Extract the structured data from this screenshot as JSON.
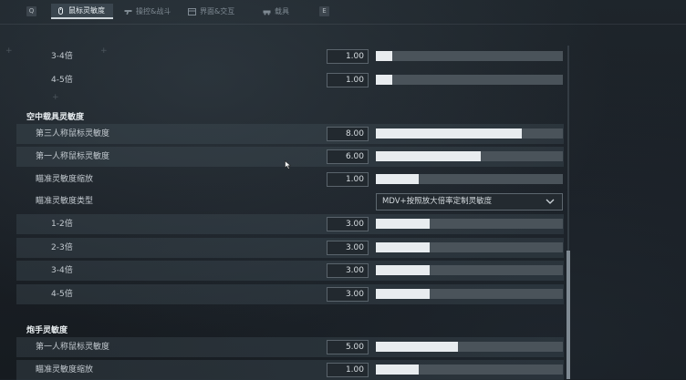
{
  "tabs": {
    "left_key": "Q",
    "right_key": "E",
    "items": [
      {
        "label": "鼠标灵敏度",
        "icon": "mouse-icon",
        "active": true
      },
      {
        "label": "操控&战斗",
        "icon": "gun-icon",
        "active": false
      },
      {
        "label": "界面&交互",
        "icon": "interface-icon",
        "active": false
      },
      {
        "label": "载具",
        "icon": "vehicle-icon",
        "active": false
      }
    ]
  },
  "rows_top": [
    {
      "label": "3-4倍",
      "value": "1.00",
      "fraction": 0.09
    },
    {
      "label": "4-5倍",
      "value": "1.00",
      "fraction": 0.09
    }
  ],
  "section_air": {
    "title": "空中载具灵敏度",
    "rows": [
      {
        "label": "第三人称鼠标灵敏度",
        "value": "8.00",
        "fraction": 0.78
      },
      {
        "label": "第一人称鼠标灵敏度",
        "value": "6.00",
        "fraction": 0.56
      },
      {
        "label": "瞄准灵敏度缩放",
        "value": "1.00",
        "fraction": 0.23
      }
    ],
    "type_label": "瞄准灵敏度类型",
    "type_value": "MDV+按照放大倍率定制灵敏度",
    "scope_rows": [
      {
        "label": "1-2倍",
        "value": "3.00",
        "fraction": 0.29
      },
      {
        "label": "2-3倍",
        "value": "3.00",
        "fraction": 0.29
      },
      {
        "label": "3-4倍",
        "value": "3.00",
        "fraction": 0.29
      },
      {
        "label": "4-5倍",
        "value": "3.00",
        "fraction": 0.29
      }
    ]
  },
  "section_gunner": {
    "title": "炮手灵敏度",
    "rows": [
      {
        "label": "第一人称鼠标灵敏度",
        "value": "5.00",
        "fraction": 0.44
      },
      {
        "label": "瞄准灵敏度缩放",
        "value": "1.00",
        "fraction": 0.23
      }
    ]
  }
}
